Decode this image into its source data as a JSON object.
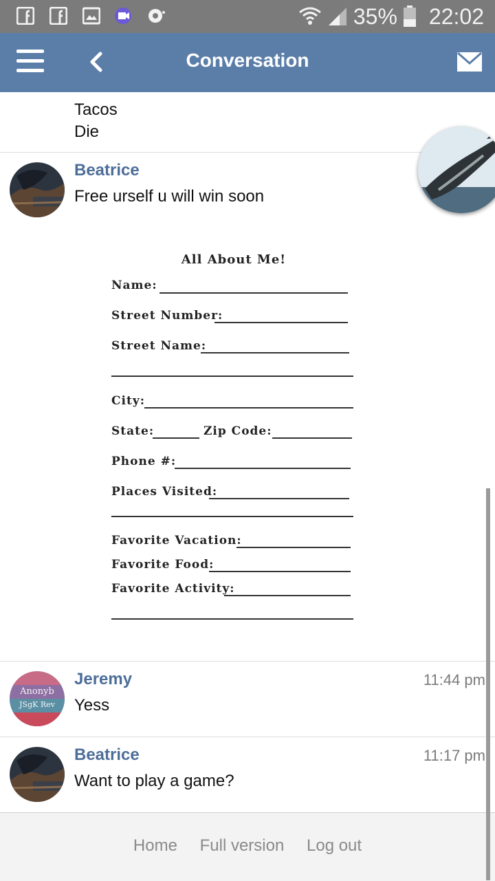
{
  "status_bar": {
    "battery": "35%",
    "time": "22:02"
  },
  "header": {
    "title": "Conversation"
  },
  "messages": [
    {
      "lines": [
        "Tacos",
        "Die"
      ]
    },
    {
      "author": "Beatrice",
      "text": "Free urself u will win soon",
      "attachment": {
        "title": "All About Me!",
        "fields": [
          "Name:",
          "Street Number:",
          "Street Name:",
          "City:",
          "State:",
          "Zip Code:",
          "Phone #:",
          "Places Visited:",
          "Favorite Vacation:",
          "Favorite Food:",
          "Favorite Activity:"
        ]
      }
    },
    {
      "author": "Jeremy",
      "time": "11:44 pm",
      "text": "Yess",
      "avatar_text": [
        "Anonyb",
        "JSgK Rev"
      ]
    },
    {
      "author": "Beatrice",
      "time": "11:17 pm",
      "text": "Want to play a game?"
    }
  ],
  "footer": {
    "links": [
      "Home",
      "Full version",
      "Log out"
    ]
  },
  "colors": {
    "status_bar": "#7b7b7b",
    "header": "#5b7ea9",
    "author": "#4d6e99",
    "footer": "#f3f3f3"
  },
  "icons": [
    "facebook-icon",
    "facebook-icon",
    "image-icon",
    "video-icon",
    "record-icon",
    "wifi-icon",
    "signal-icon",
    "battery-icon",
    "menu-icon",
    "back-arrow-icon",
    "mail-icon"
  ]
}
